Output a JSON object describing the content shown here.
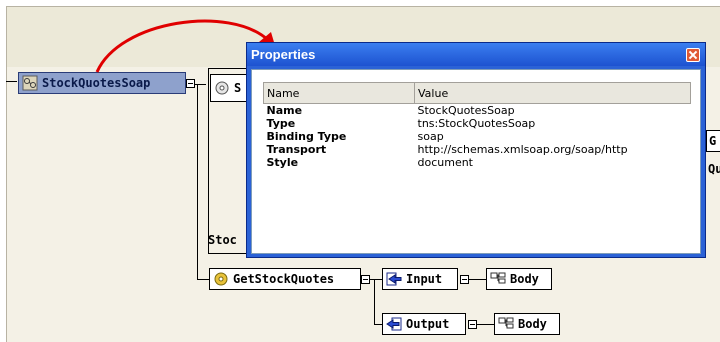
{
  "dialog": {
    "title": "Properties",
    "columns": {
      "name": "Name",
      "value": "Value"
    },
    "rows": [
      {
        "key": "Name",
        "value": "StockQuotesSoap"
      },
      {
        "key": "Type",
        "value": "tns:StockQuotesSoap"
      },
      {
        "key": "Binding Type",
        "value": "soap"
      },
      {
        "key": "Transport",
        "value": "http://schemas.xmlsoap.org/soap/http"
      },
      {
        "key": "Style",
        "value": "document"
      }
    ]
  },
  "diagram": {
    "binding_node": "StockQuotesSoap",
    "partial_node_s": "S",
    "partial_text_stoc": "Stoc",
    "operation_node": "GetStockQuotes",
    "input_node": "Input",
    "output_node": "Output",
    "body_label": "Body",
    "right_partial_g": "G",
    "right_partial_q": "Qu"
  },
  "colors": {
    "canvas": "#f4f1e6",
    "selected_node": "#8ea1cc",
    "dialog_frame": "#2b62d6",
    "arrow": "#e00000",
    "close_button": "#e05a35"
  },
  "icons": [
    "binding-icon",
    "operation-gear-icon",
    "input-arrow-icon",
    "output-arrow-icon",
    "body-element-icon",
    "close-icon"
  ]
}
